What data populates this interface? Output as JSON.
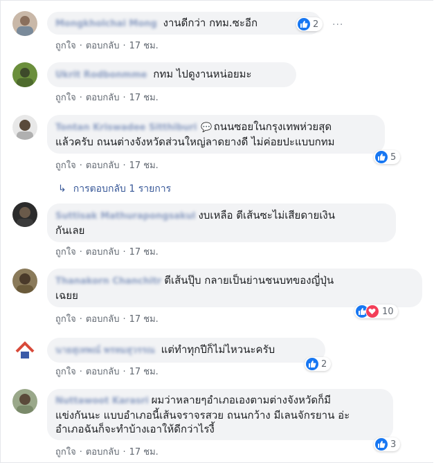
{
  "comments": [
    {
      "author": "Mongkholchai Mong",
      "text": "งานดีกว่า กทม.ซะอีก",
      "actions": {
        "like": "ถูกใจ",
        "reply": "ตอบกลับ",
        "time": "17 ชม."
      },
      "reaction_count": "2"
    },
    {
      "author": "Ukrit Rodbonmme",
      "text": "กทม ไปดูงานหน่อยมะ",
      "actions": {
        "like": "ถูกใจ",
        "reply": "ตอบกลับ",
        "time": "17 ชม."
      }
    },
    {
      "author": "Tontan Kriswadee Sitthiburi",
      "text_line1": "ถนนซอยในกรุงเทพห่วยสุด",
      "text_line2": "แล้วครับ ถนนต่างจังหวัดส่วนใหญ่ลาดยางดี ไม่ค่อยปะแบบกทม",
      "actions": {
        "like": "ถูกใจ",
        "reply": "ตอบกลับ",
        "time": "17 ชม."
      },
      "reaction_count": "5",
      "replies": "การตอบกลับ 1 รายการ"
    },
    {
      "author": "Suttisak Mathurapongsakul",
      "text_line1": "งบเหลือ ตีเส้นซะไม่เสียดายเงิน",
      "text_line2": "กันเลย",
      "actions": {
        "like": "ถูกใจ",
        "reply": "ตอบกลับ",
        "time": "17 ชม."
      }
    },
    {
      "author": "Thanakorn Chanchitr",
      "text_line1": "ตีเส้นปุ๊บ กลายเป็นย่านชนบทของญี่ปุ่น",
      "text_line2": "เฉยย",
      "actions": {
        "like": "ถูกใจ",
        "reply": "ตอบกลับ",
        "time": "17 ชม."
      },
      "reaction_count": "10"
    },
    {
      "author": "นายสุเทพณ์ พรหมสุวรรณ",
      "text": "แต่ทำทุกปีก็ไม่ไหวนะครับ",
      "actions": {
        "like": "ถูกใจ",
        "reply": "ตอบกลับ",
        "time": "17 ชม."
      },
      "reaction_count": "2"
    },
    {
      "author": "Nuttawoot Karasri",
      "text_line1": "ผมว่าหลายๆอำเภอเองตามต่างจังหวัดก็มี",
      "text_line2": "แข่งกันนะ แบบอำเภอนี้เส้นจราจรสวย ถนนกว้าง มีเลนจักรยาน อ่ะ",
      "text_line3": "อำเภอฉันก็จะทำบ้างเอาให้ดีกว่าไรงี้",
      "actions": {
        "like": "ถูกใจ",
        "reply": "ตอบกลับ",
        "time": "17 ชม."
      },
      "reaction_count": "3"
    }
  ],
  "icons": {
    "like": "like-thumb-icon",
    "love": "love-heart-icon",
    "more": "more-options-icon",
    "reply_arrow": "reply-arrow-icon"
  },
  "colors": {
    "link": "#385898",
    "bubble": "#f2f3f5",
    "like": "#1877f2",
    "love": "#f33e58"
  }
}
